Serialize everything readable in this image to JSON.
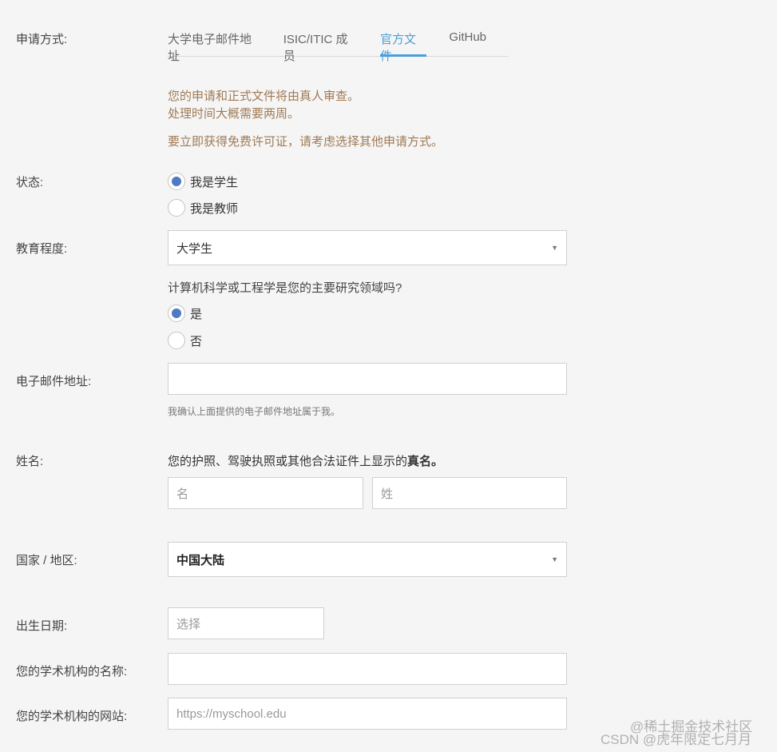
{
  "labels": {
    "method": "申请方式:",
    "status": "状态:",
    "education": "教育程度:",
    "email": "电子邮件地址:",
    "name": "姓名:",
    "country": "国家 / 地区:",
    "birth": "出生日期:",
    "institution_name": "您的学术机构的名称:",
    "institution_site": "您的学术机构的网站:"
  },
  "tabs": [
    {
      "label": "大学电子邮件地址",
      "active": false
    },
    {
      "label": "ISIC/ITIC 成员",
      "active": false
    },
    {
      "label": "官方文件",
      "active": true
    },
    {
      "label": "GitHub",
      "active": false
    }
  ],
  "notice": {
    "line1": "您的申请和正式文件将由真人审查。",
    "line2": "处理时间大概需要两周。",
    "line3": "要立即获得免费许可证，请考虑选择其他申请方式。"
  },
  "status_options": [
    {
      "label": "我是学生",
      "checked": true
    },
    {
      "label": "我是教师",
      "checked": false
    }
  ],
  "education": {
    "value": "大学生"
  },
  "cs_question": {
    "text": "计算机科学或工程学是您的主要研究领域吗?",
    "options": [
      {
        "label": "是",
        "checked": true
      },
      {
        "label": "否",
        "checked": false
      }
    ]
  },
  "email": {
    "value": "",
    "hint": "我确认上面提供的电子邮件地址属于我。"
  },
  "name": {
    "desc_prefix": "您的护照、驾驶执照或其他合法证件上显示的",
    "desc_bold": "真名。",
    "first_placeholder": "名",
    "last_placeholder": "姓"
  },
  "country": {
    "value": "中国大陆"
  },
  "birth": {
    "placeholder": "选择"
  },
  "institution": {
    "name_value": "",
    "site_placeholder": "https://myschool.edu"
  },
  "watermarks": {
    "line1": "@稀土掘金技术社区",
    "line2": "CSDN @虎年限定七月月"
  },
  "colors": {
    "accent": "#4a9ed8",
    "notice": "#a07a55",
    "radio_dot": "#4f79c4"
  }
}
